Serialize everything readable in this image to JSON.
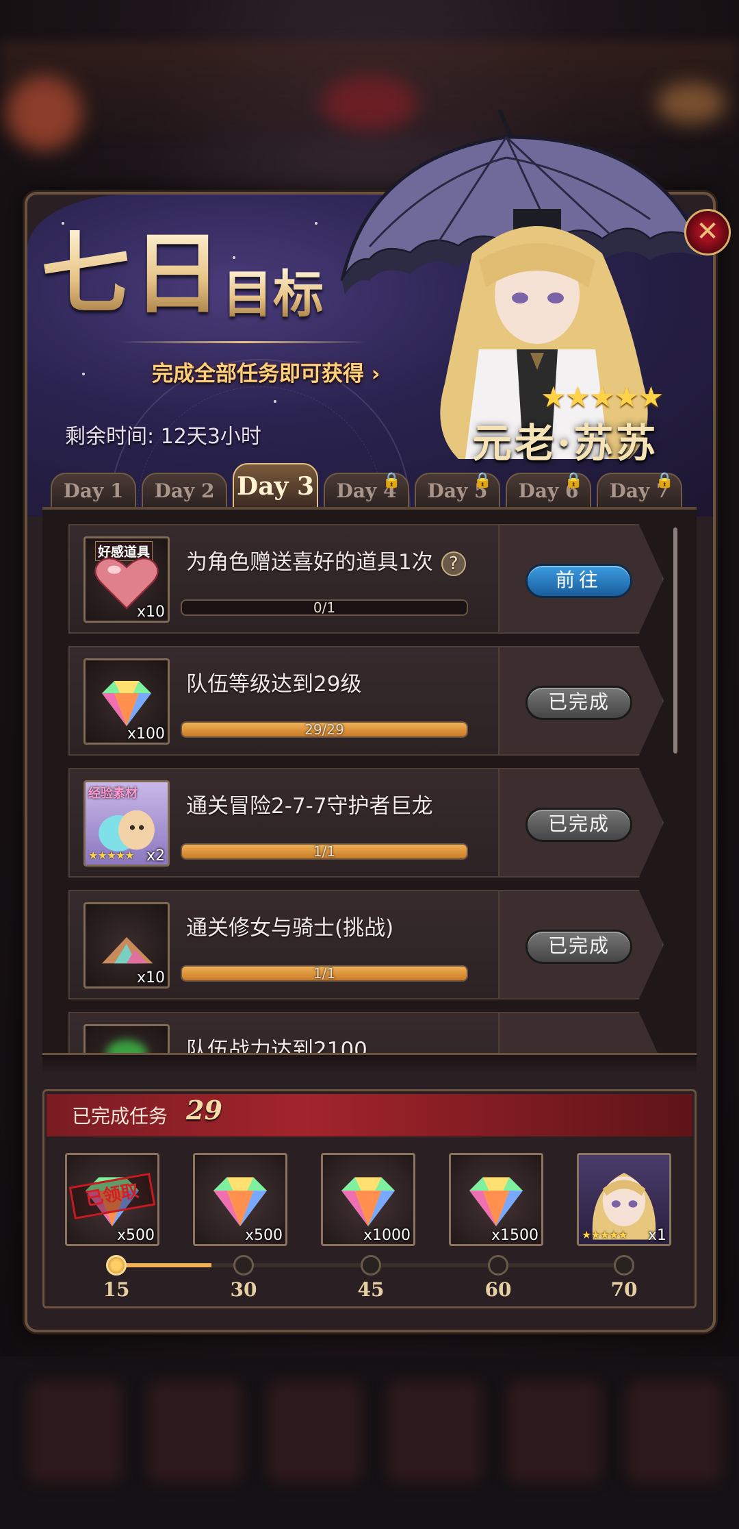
{
  "header": {
    "title_big": "七日",
    "title_small": "目标",
    "subtitle": "完成全部任务即可获得",
    "remaining_label": "剩余时间:",
    "remaining_value": "12天3小时",
    "character_name": "元老·苏苏",
    "character_stars": "★★★★★",
    "close_icon": "close-icon"
  },
  "tabs": [
    {
      "label": "Day 1",
      "locked": false
    },
    {
      "label": "Day 2",
      "locked": false
    },
    {
      "label": "Day 3",
      "locked": false,
      "active": true
    },
    {
      "label": "Day 4",
      "locked": true
    },
    {
      "label": "Day 5",
      "locked": true
    },
    {
      "label": "Day 6",
      "locked": true
    },
    {
      "label": "Day 7",
      "locked": true
    }
  ],
  "tasks": [
    {
      "title": "为角色赠送喜好的道具1次",
      "has_help": true,
      "progress_text": "0/1",
      "progress": 0,
      "qty": "x10",
      "icon": "heart-icon",
      "tag": "好感道具",
      "button": "前往",
      "state": "go"
    },
    {
      "title": "队伍等级达到29级",
      "has_help": false,
      "progress_text": "29/29",
      "progress": 1,
      "qty": "x100",
      "icon": "diamond-icon",
      "button": "已完成",
      "state": "done"
    },
    {
      "title": "通关冒险2-7-7守护者巨龙",
      "has_help": false,
      "progress_text": "1/1",
      "progress": 1,
      "qty": "x2",
      "icon": "exp-material-icon",
      "tag": "经验素材",
      "stars": "★★★★★",
      "button": "已完成",
      "state": "done"
    },
    {
      "title": "通关修女与骑士(挑战)",
      "has_help": false,
      "progress_text": "1/1",
      "progress": 1,
      "qty": "x10",
      "icon": "dust-icon",
      "button": "已完成",
      "state": "done"
    },
    {
      "title": "队伍战力达到2100",
      "partial": true
    }
  ],
  "rewards_section": {
    "label": "已完成任务",
    "count": "29",
    "claimed_stamp": "已领取",
    "items": [
      {
        "qty": "x500",
        "icon": "diamond-icon",
        "claimed": true
      },
      {
        "qty": "x500",
        "icon": "diamond-icon"
      },
      {
        "qty": "x1000",
        "icon": "diamond-icon"
      },
      {
        "qty": "x1500",
        "icon": "diamond-icon"
      },
      {
        "qty": "x1",
        "icon": "character-portrait-icon",
        "stars": "★★★★★"
      }
    ],
    "milestones": [
      "15",
      "30",
      "45",
      "60",
      "70"
    ],
    "progress_fraction": 0.19
  },
  "colors": {
    "accent_gold": "#e6c487",
    "go_button": "#2a7fc5",
    "done_button": "#5f5f5f",
    "reward_header": "#a2242c"
  }
}
